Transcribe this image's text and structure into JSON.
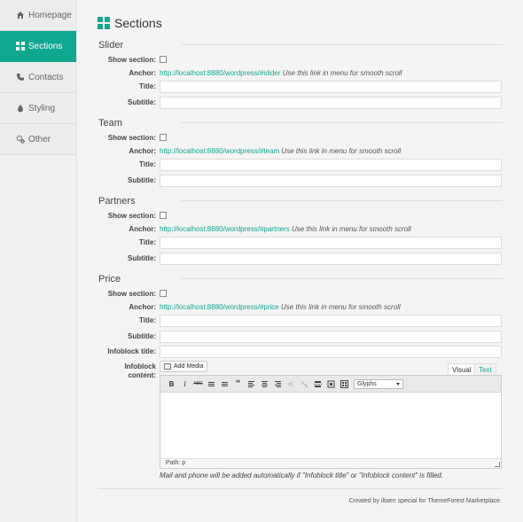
{
  "sidebar": {
    "items": [
      {
        "label": "Homepage",
        "icon": "home-icon"
      },
      {
        "label": "Sections",
        "icon": "grid-icon"
      },
      {
        "label": "Contacts",
        "icon": "phone-icon"
      },
      {
        "label": "Styling",
        "icon": "drop-icon"
      },
      {
        "label": "Other",
        "icon": "gears-icon"
      }
    ]
  },
  "page": {
    "title": "Sections",
    "accent": "#10a78f"
  },
  "labels": {
    "show": "Show section:",
    "anchor": "Anchor:",
    "title": "Title:",
    "subtitle": "Subtitle:",
    "infoblock_title": "Infoblock title:",
    "infoblock_content_1": "Infoblock",
    "infoblock_content_2": "content:"
  },
  "anchor_note": "Use this link in menu for smooth scroll",
  "sections": [
    {
      "name": "Slider",
      "url": "http://localhost:8880/wordpress/#slider"
    },
    {
      "name": "Team",
      "url": "http://localhost:8880/wordpress/#team"
    },
    {
      "name": "Partners",
      "url": "http://localhost:8880/wordpress/#partners"
    },
    {
      "name": "Price",
      "url": "http://localhost:8880/wordpress/#price"
    }
  ],
  "editor": {
    "add_media": "Add Media",
    "tab_visual": "Visual",
    "tab_text": "Text",
    "glyphs": "Glyphs",
    "path": "Path: p",
    "bold": "B",
    "italic": "I",
    "strike": "ABC",
    "quote": "“"
  },
  "help_text": "Mail and phone will be added automatically if \"Infoblock title\" or \"Infoblock content\" is filled.",
  "credits": "Created by iltaen special for ThemeForest Marketplace."
}
